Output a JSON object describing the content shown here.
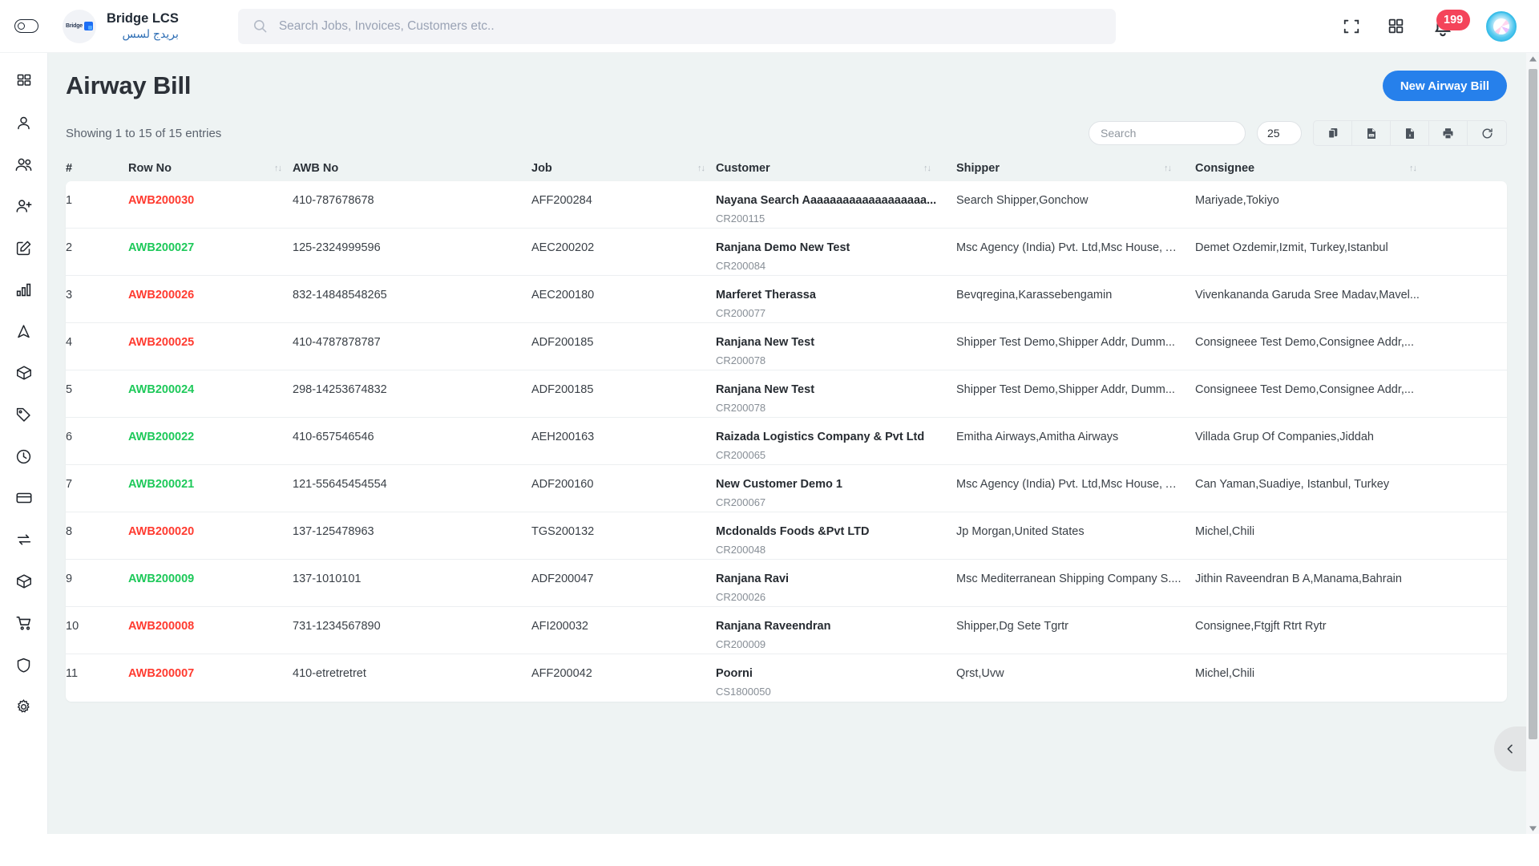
{
  "header": {
    "sidebar_toggle_icon": "toggle-switch-icon",
    "brand_name_en": "Bridge LCS",
    "brand_name_ar": "بريدج لسس",
    "brand_logo_text": "Bridge",
    "search": {
      "placeholder": "Search Jobs, Invoices, Customers etc.."
    },
    "fullscreen_icon": "fullscreen-icon",
    "apps_icon": "apps-grid-icon",
    "notification_icon": "bell-icon",
    "notification_count": "199",
    "avatar_icon": "user-avatar"
  },
  "sidebar": {
    "items": [
      {
        "icon": "dashboard-grid-icon",
        "name": "dashboard"
      },
      {
        "icon": "user-icon",
        "name": "user"
      },
      {
        "icon": "users-icon",
        "name": "customers"
      },
      {
        "icon": "user-plus-icon",
        "name": "add-user"
      },
      {
        "icon": "edit-square-icon",
        "name": "quotation"
      },
      {
        "icon": "bar-chart-icon",
        "name": "reports"
      },
      {
        "icon": "navigation-icon",
        "name": "jobs"
      },
      {
        "icon": "box-icon",
        "name": "packages"
      },
      {
        "icon": "tag-icon",
        "name": "pricing"
      },
      {
        "icon": "clock-icon",
        "name": "history"
      },
      {
        "icon": "credit-card-icon",
        "name": "payments"
      },
      {
        "icon": "exchange-icon",
        "name": "transactions"
      },
      {
        "icon": "cube-3d-icon",
        "name": "inventory"
      },
      {
        "icon": "cart-icon",
        "name": "purchase"
      },
      {
        "icon": "shield-icon",
        "name": "security"
      },
      {
        "icon": "gear-icon",
        "name": "settings"
      }
    ]
  },
  "page": {
    "title": "Airway Bill",
    "new_button_label": "New Airway Bill",
    "entries_info": "Showing 1 to 15 of 15 entries"
  },
  "toolbar": {
    "search_placeholder": "Search",
    "page_length": "25",
    "buttons": [
      {
        "icon": "copy-icon",
        "name": "copy-button"
      },
      {
        "icon": "csv-file-icon",
        "name": "csv-export-button"
      },
      {
        "icon": "excel-file-icon",
        "name": "excel-export-button"
      },
      {
        "icon": "printer-icon",
        "name": "print-button"
      },
      {
        "icon": "refresh-icon",
        "name": "refresh-button"
      }
    ]
  },
  "table": {
    "columns": [
      {
        "label": "#",
        "sortable": false
      },
      {
        "label": "Row No",
        "sortable": true
      },
      {
        "label": "AWB No",
        "sortable": false
      },
      {
        "label": "Job",
        "sortable": true
      },
      {
        "label": "Customer",
        "sortable": true
      },
      {
        "label": "Shipper",
        "sortable": true
      },
      {
        "label": "Consignee",
        "sortable": true
      }
    ],
    "sort_glyph": "↑↓",
    "rows": [
      {
        "index": "1",
        "row_no": "AWB200030",
        "row_no_color": "red",
        "awb_no": "410-787678678",
        "job": "AFF200284",
        "customer": "Nayana Search Aaaaaaaaaaaaaaaaaaa...",
        "customer_code": "CR200115",
        "shipper": "Search Shipper,Gonchow",
        "consignee": "Mariyade,Tokiyo"
      },
      {
        "index": "2",
        "row_no": "AWB200027",
        "row_no_color": "green",
        "awb_no": "125-2324999596",
        "job": "AEC200202",
        "customer": "Ranjana Demo New Test",
        "customer_code": "CR200084",
        "shipper": "Msc Agency (India) Pvt. Ltd,Msc House, A...",
        "consignee": "Demet Ozdemir,Izmit, Turkey,Istanbul"
      },
      {
        "index": "3",
        "row_no": "AWB200026",
        "row_no_color": "red",
        "awb_no": "832-14848548265",
        "job": "AEC200180",
        "customer": "Marferet Therassa",
        "customer_code": "CR200077",
        "shipper": "Bevqregina,Karassebengamin",
        "consignee": "Vivenkananda Garuda Sree Madav,Mavel..."
      },
      {
        "index": "4",
        "row_no": "AWB200025",
        "row_no_color": "red",
        "awb_no": "410-4787878787",
        "job": "ADF200185",
        "customer": "Ranjana New Test",
        "customer_code": "CR200078",
        "shipper": "Shipper Test Demo,Shipper Addr, Dumm...",
        "consignee": "Consigneee Test Demo,Consignee Addr,..."
      },
      {
        "index": "5",
        "row_no": "AWB200024",
        "row_no_color": "green",
        "awb_no": "298-14253674832",
        "job": "ADF200185",
        "customer": "Ranjana New Test",
        "customer_code": "CR200078",
        "shipper": "Shipper Test Demo,Shipper Addr, Dumm...",
        "consignee": "Consigneee Test Demo,Consignee Addr,..."
      },
      {
        "index": "6",
        "row_no": "AWB200022",
        "row_no_color": "green",
        "awb_no": "410-657546546",
        "job": "AEH200163",
        "customer": "Raizada Logistics Company & Pvt Ltd",
        "customer_code": "CR200065",
        "shipper": "Emitha Airways,Amitha Airways",
        "consignee": "Villada Grup Of Companies,Jiddah"
      },
      {
        "index": "7",
        "row_no": "AWB200021",
        "row_no_color": "green",
        "awb_no": "121-55645454554",
        "job": "ADF200160",
        "customer": "New Customer Demo 1",
        "customer_code": "CR200067",
        "shipper": "Msc Agency (India) Pvt. Ltd,Msc House, A...",
        "consignee": "Can Yaman,Suadiye, Istanbul, Turkey"
      },
      {
        "index": "8",
        "row_no": "AWB200020",
        "row_no_color": "red",
        "awb_no": "137-125478963",
        "job": "TGS200132",
        "customer": "Mcdonalds Foods &Pvt LTD",
        "customer_code": "CR200048",
        "shipper": "Jp Morgan,United States",
        "consignee": "Michel,Chili"
      },
      {
        "index": "9",
        "row_no": "AWB200009",
        "row_no_color": "green",
        "awb_no": "137-1010101",
        "job": "ADF200047",
        "customer": "Ranjana Ravi",
        "customer_code": "CR200026",
        "shipper": "Msc Mediterranean Shipping Company S....",
        "consignee": "Jithin Raveendran B A,Manama,Bahrain"
      },
      {
        "index": "10",
        "row_no": "AWB200008",
        "row_no_color": "red",
        "awb_no": "731-1234567890",
        "job": "AFI200032",
        "customer": "Ranjana Raveendran",
        "customer_code": "CR200009",
        "shipper": "Shipper,Dg Sete Tgrtr",
        "consignee": "Consignee,Ftgjft Rtrt Rytr"
      },
      {
        "index": "11",
        "row_no": "AWB200007",
        "row_no_color": "red",
        "awb_no": "410-etretretret",
        "job": "AFF200042",
        "customer": "Poorni",
        "customer_code": "CS1800050",
        "shipper": "Qrst,Uvw",
        "consignee": "Michel,Chili"
      }
    ]
  },
  "right_edge": {
    "collapse_icon": "chevron-left-icon"
  },
  "colors": {
    "accent": "#2680eb",
    "danger": "#ff3b30",
    "success": "#1ec95a",
    "badge": "#f4445a",
    "page_bg": "#eef3f3"
  }
}
